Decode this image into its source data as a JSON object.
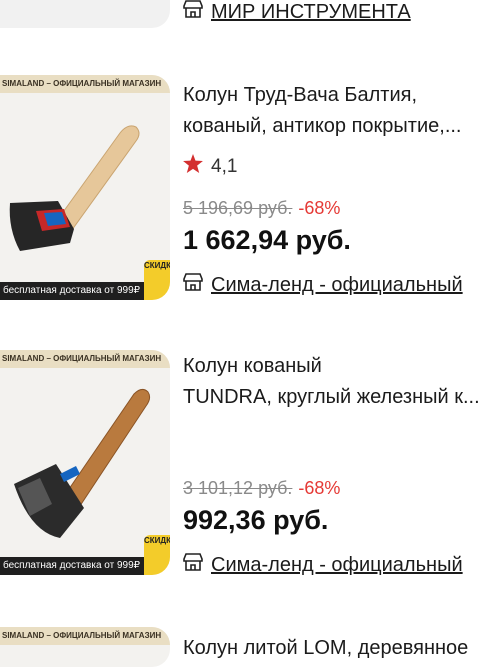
{
  "top": {
    "store_label": "МИР ИНСТРУМЕНТА"
  },
  "products": [
    {
      "banner": "SIMALAND – ОФИЦИАЛЬНЫЙ МАГАЗИН",
      "footer": "бесплатная доставка от 999₽",
      "badge": "СКИДКИ",
      "title_line1": "Колун Труд-Вача Балтия,",
      "title_line2": "кованый, антикор покрытие,...",
      "rating": "4,1",
      "old_price": "5 196,69 руб.",
      "discount": "-68%",
      "price": "1 662,94 руб.",
      "seller": "Сима-ленд - официальный"
    },
    {
      "banner": "SIMALAND – ОФИЦИАЛЬНЫЙ МАГАЗИН",
      "footer": "бесплатная доставка от 999₽",
      "badge": "СКИДКИ",
      "title_line1": "Колун кованый",
      "title_line2": "TUNDRA, круглый железный к...",
      "old_price": "3 101,12 руб.",
      "discount": "-68%",
      "price": "992,36 руб.",
      "seller": "Сима-ленд - официальный"
    },
    {
      "banner": "SIMALAND – ОФИЦИАЛЬНЫЙ МАГАЗИН",
      "title_line1": "Колун литой LOM, деревянное"
    }
  ],
  "colors": {
    "star": "#d32f2f",
    "discount": "#e53935",
    "banner": "#e9dec3"
  }
}
